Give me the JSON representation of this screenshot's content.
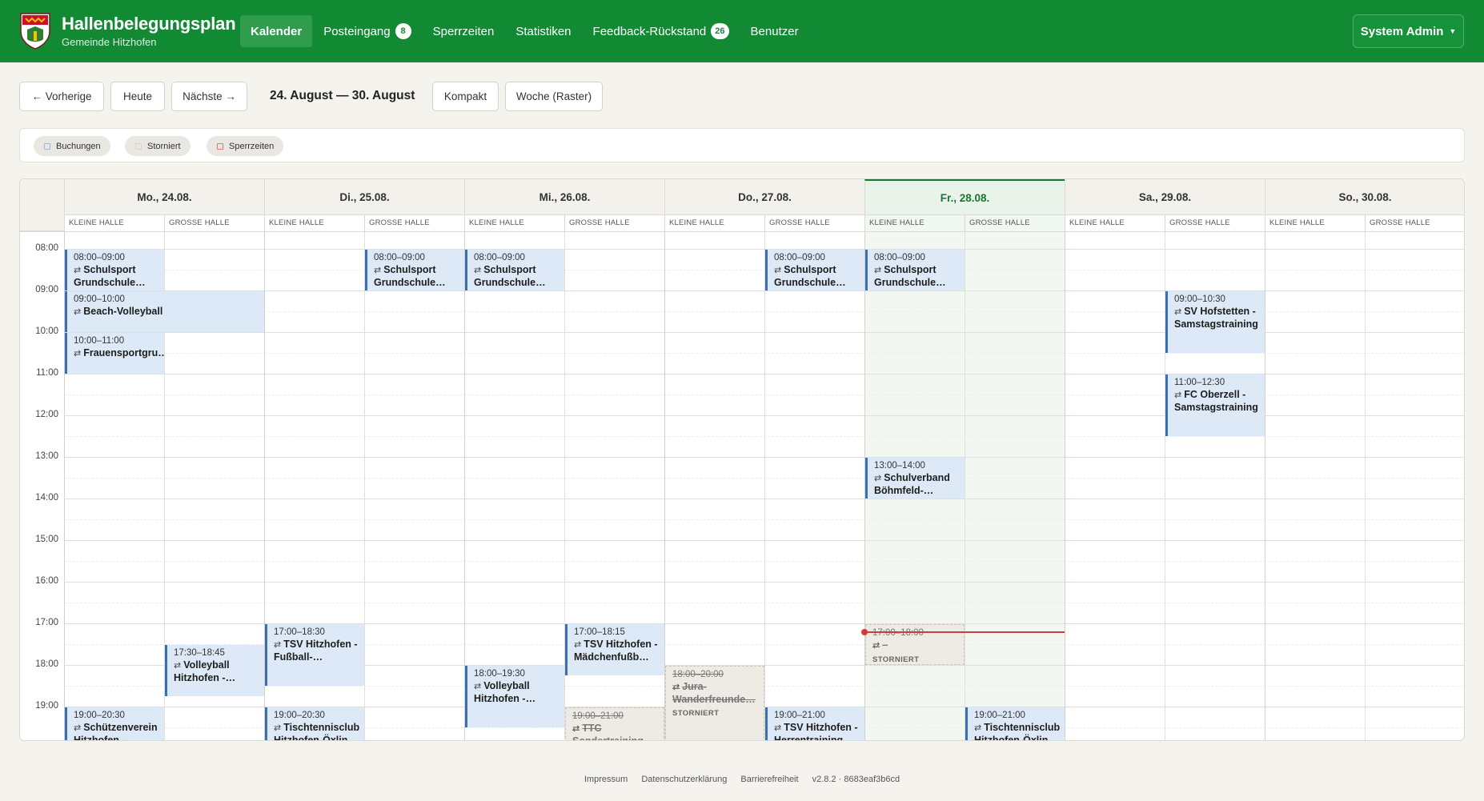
{
  "brand": {
    "title": "Hallenbelegungsplan",
    "subtitle": "Gemeinde Hitzhofen"
  },
  "nav": {
    "items": [
      {
        "label": "Kalender",
        "active": true
      },
      {
        "label": "Posteingang",
        "badge": "8"
      },
      {
        "label": "Sperrzeiten"
      },
      {
        "label": "Statistiken"
      },
      {
        "label": "Feedback-Rückstand",
        "badge": "26"
      },
      {
        "label": "Benutzer"
      }
    ],
    "user": "System Admin"
  },
  "toolbar": {
    "prev": "← Vorherige",
    "today": "Heute",
    "next": "Nächste →",
    "range": "24. August — 30. August",
    "compact": "Kompakt",
    "week_grid": "Woche (Raster)"
  },
  "legend": [
    {
      "label": "Buchungen",
      "color": "#9fb7e0"
    },
    {
      "label": "Storniert",
      "color": "#d8d4cc"
    },
    {
      "label": "Sperrzeiten",
      "color": "#e57373"
    }
  ],
  "calendar": {
    "days": [
      "Mo., 24.08.",
      "Di., 25.08.",
      "Mi., 26.08.",
      "Do., 27.08.",
      "Fr., 28.08.",
      "Sa., 29.08.",
      "So., 30.08."
    ],
    "today_index": 4,
    "halls": [
      "KLEINE HALLE",
      "GROSSE HALLE"
    ],
    "hours": [
      "08:00",
      "09:00",
      "10:00",
      "11:00",
      "12:00",
      "13:00",
      "14:00",
      "15:00",
      "16:00",
      "17:00",
      "18:00",
      "19:00"
    ],
    "repeat_icon": "repeat-icon",
    "events": [
      {
        "day": 0,
        "hall": 0,
        "start": 8,
        "end": 9,
        "time": "08:00–09:00",
        "name": "Schulsport Grundschule…"
      },
      {
        "day": 0,
        "hall": 0,
        "span": 2,
        "start": 9,
        "end": 10,
        "time": "09:00–10:00",
        "name": "Beach-Volleyball"
      },
      {
        "day": 0,
        "hall": 0,
        "start": 10,
        "end": 11,
        "time": "10:00–11:00",
        "name": "Frauensportgru…"
      },
      {
        "day": 0,
        "hall": 1,
        "start": 17.5,
        "end": 18.75,
        "time": "17:30–18:45",
        "name": "Volleyball Hitzhofen -…"
      },
      {
        "day": 0,
        "hall": 0,
        "start": 19,
        "end": 20.5,
        "time": "19:00–20:30",
        "name": "Schützenverein Hitzhofen -…"
      },
      {
        "day": 1,
        "hall": 1,
        "start": 8,
        "end": 9,
        "time": "08:00–09:00",
        "name": "Schulsport Grundschule…"
      },
      {
        "day": 1,
        "hall": 0,
        "start": 17,
        "end": 18.5,
        "time": "17:00–18:30",
        "name": "TSV Hitzhofen - Fußball-…"
      },
      {
        "day": 1,
        "hall": 0,
        "start": 19,
        "end": 20.5,
        "time": "19:00–20:30",
        "name": "Tischtennisclub Hitzhofen-Öxlin…"
      },
      {
        "day": 2,
        "hall": 0,
        "start": 8,
        "end": 9,
        "time": "08:00–09:00",
        "name": "Schulsport Grundschule…"
      },
      {
        "day": 2,
        "hall": 1,
        "start": 17,
        "end": 18.25,
        "time": "17:00–18:15",
        "name": "TSV Hitzhofen - Mädchenfußb…"
      },
      {
        "day": 2,
        "hall": 0,
        "start": 18,
        "end": 19.5,
        "time": "18:00–19:30",
        "name": "Volleyball Hitzhofen -…"
      },
      {
        "day": 2,
        "hall": 1,
        "start": 19,
        "end": 21,
        "time": "19:00–21:00",
        "name": "TTC Sondertraining",
        "cancelled": true
      },
      {
        "day": 3,
        "hall": 0,
        "start": 18,
        "end": 20,
        "time": "18:00–20:00",
        "name": "Jura-Wanderfreunde…",
        "cancelled": true,
        "status": "STORNIERT"
      },
      {
        "day": 3,
        "hall": 1,
        "start": 8,
        "end": 9,
        "time": "08:00–09:00",
        "name": "Schulsport Grundschule…"
      },
      {
        "day": 3,
        "hall": 1,
        "start": 19,
        "end": 21,
        "time": "19:00–21:00",
        "name": "TSV Hitzhofen - Herrentraining"
      },
      {
        "day": 4,
        "hall": 0,
        "start": 8,
        "end": 9,
        "time": "08:00–09:00",
        "name": "Schulsport Grundschule…"
      },
      {
        "day": 4,
        "hall": 0,
        "start": 13,
        "end": 14,
        "time": "13:00–14:00",
        "name": "Schulverband Böhmfeld-…"
      },
      {
        "day": 4,
        "hall": 0,
        "start": 17,
        "end": 18,
        "time": "17:00–18:00",
        "name": "–",
        "cancelled": true,
        "status": "STORNIERT"
      },
      {
        "day": 4,
        "hall": 1,
        "start": 19,
        "end": 21,
        "time": "19:00–21:00",
        "name": "Tischtennisclub Hitzhofen-Öxlin…"
      },
      {
        "day": 5,
        "hall": 1,
        "start": 9,
        "end": 10.5,
        "time": "09:00–10:30",
        "name": "SV Hofstetten - Samstagstraining"
      },
      {
        "day": 5,
        "hall": 1,
        "start": 11,
        "end": 12.5,
        "time": "11:00–12:30",
        "name": "FC Oberzell - Samstagstraining"
      }
    ],
    "now_hour": 17.2
  },
  "footer": {
    "links": [
      "Impressum",
      "Datenschutzerklärung",
      "Barrierefreiheit"
    ],
    "version": "v2.8.2 · 8683eaf3b6cd"
  }
}
